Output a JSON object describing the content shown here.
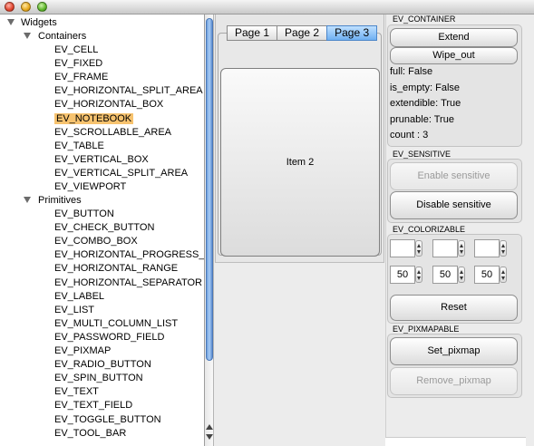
{
  "tree": {
    "root_label": "Widgets",
    "containers_label": "Containers",
    "containers": [
      "EV_CELL",
      "EV_FIXED",
      "EV_FRAME",
      "EV_HORIZONTAL_SPLIT_AREA",
      "EV_HORIZONTAL_BOX",
      "EV_NOTEBOOK",
      "EV_SCROLLABLE_AREA",
      "EV_TABLE",
      "EV_VERTICAL_BOX",
      "EV_VERTICAL_SPLIT_AREA",
      "EV_VIEWPORT"
    ],
    "selected": "EV_NOTEBOOK",
    "primitives_label": "Primitives",
    "primitives": [
      "EV_BUTTON",
      "EV_CHECK_BUTTON",
      "EV_COMBO_BOX",
      "EV_HORIZONTAL_PROGRESS_BAR",
      "EV_HORIZONTAL_RANGE",
      "EV_HORIZONTAL_SEPARATOR",
      "EV_LABEL",
      "EV_LIST",
      "EV_MULTI_COLUMN_LIST",
      "EV_PASSWORD_FIELD",
      "EV_PIXMAP",
      "EV_RADIO_BUTTON",
      "EV_SPIN_BUTTON",
      "EV_TEXT",
      "EV_TEXT_FIELD",
      "EV_TOGGLE_BUTTON",
      "EV_TOOL_BAR"
    ],
    "colors": {
      "selection": "#f7c36f",
      "scrollbar_thumb": "#8fb9ec"
    }
  },
  "notebook": {
    "tabs": [
      "Page 1",
      "Page 2",
      "Page 3"
    ],
    "active_tab": "Page 3",
    "item_label": "Item 2"
  },
  "container": {
    "title": "EV_CONTAINER",
    "extend_label": "Extend",
    "wipe_out_label": "Wipe_out",
    "props": [
      "full: False",
      "is_empty: False",
      "extendible: True",
      "prunable: True",
      "count : 3"
    ]
  },
  "sensitive": {
    "title": "EV_SENSITIVE",
    "enable_label": "Enable sensitive",
    "disable_label": "Disable sensitive"
  },
  "colorizable": {
    "title": "EV_COLORIZABLE",
    "top_values": [
      "",
      "",
      ""
    ],
    "bottom_values": [
      "50",
      "50",
      "50"
    ],
    "reset_label": "Reset"
  },
  "pixmapable": {
    "title": "EV_PIXMAPABLE",
    "set_label": "Set_pixmap",
    "remove_label": "Remove_pixmap"
  }
}
